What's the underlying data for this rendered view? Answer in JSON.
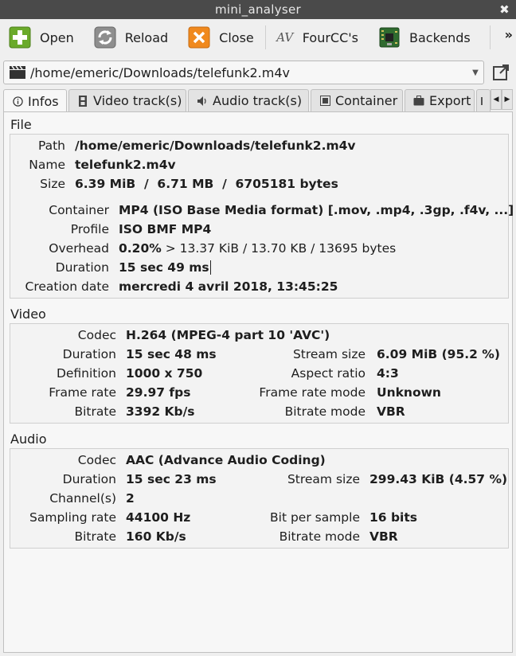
{
  "window": {
    "title": "mini_analyser",
    "close_glyph": "✖"
  },
  "toolbar": {
    "open": "Open",
    "reload": "Reload",
    "close": "Close",
    "fourcc": "FourCC's",
    "fourcc_icon_text": "AV",
    "backends": "Backends",
    "more": "»"
  },
  "file_selector": {
    "value": "/home/emeric/Downloads/telefunk2.m4v"
  },
  "tabs": [
    "Infos",
    "Video track(s)",
    "Audio track(s)",
    "Container",
    "Export"
  ],
  "file": {
    "section": "File",
    "path_label": "Path",
    "path": "/home/emeric/Downloads/telefunk2.m4v",
    "name_label": "Name",
    "name": "telefunk2.m4v",
    "size_label": "Size",
    "size": "6.39 MiB  /  6.71 MB  /  6705181 bytes",
    "container_label": "Container",
    "container": "MP4 (ISO Base Media format) [.mov, .mp4, .3gp, .f4v, ...]",
    "profile_label": "Profile",
    "profile": "ISO BMF MP4",
    "overhead_label": "Overhead",
    "overhead_pct": "0.20%",
    "overhead_rest": " > 13.37 KiB / 13.70 KB / 13695 bytes",
    "duration_label": "Duration",
    "duration": "15 sec 49 ms",
    "creation_label": "Creation date",
    "creation": "mercredi 4 avril 2018, 13:45:25"
  },
  "video": {
    "section": "Video",
    "codec_label": "Codec",
    "codec": "H.264 (MPEG-4 part 10 'AVC')",
    "duration_label": "Duration",
    "duration": "15 sec 48 ms",
    "stream_size_label": "Stream size",
    "stream_size": "6.09 MiB (95.2 %)",
    "definition_label": "Definition",
    "definition": "1000 x 750",
    "aspect_label": "Aspect ratio",
    "aspect": "4:3",
    "framerate_label": "Frame rate",
    "framerate": "29.97 fps",
    "framerate_mode_label": "Frame rate mode",
    "framerate_mode": "Unknown",
    "bitrate_label": "Bitrate",
    "bitrate": "3392 Kb/s",
    "bitrate_mode_label": "Bitrate mode",
    "bitrate_mode": "VBR"
  },
  "audio": {
    "section": "Audio",
    "codec_label": "Codec",
    "codec": "AAC (Advance Audio Coding)",
    "duration_label": "Duration",
    "duration": "15 sec 23 ms",
    "stream_size_label": "Stream size",
    "stream_size": "299.43 KiB (4.57 %)",
    "channels_label": "Channel(s)",
    "channels": "2",
    "sampling_label": "Sampling rate",
    "sampling": "44100 Hz",
    "bps_label": "Bit per sample",
    "bps": "16 bits",
    "bitrate_label": "Bitrate",
    "bitrate": "160 Kb/s",
    "bitrate_mode_label": "Bitrate mode",
    "bitrate_mode": "VBR"
  }
}
